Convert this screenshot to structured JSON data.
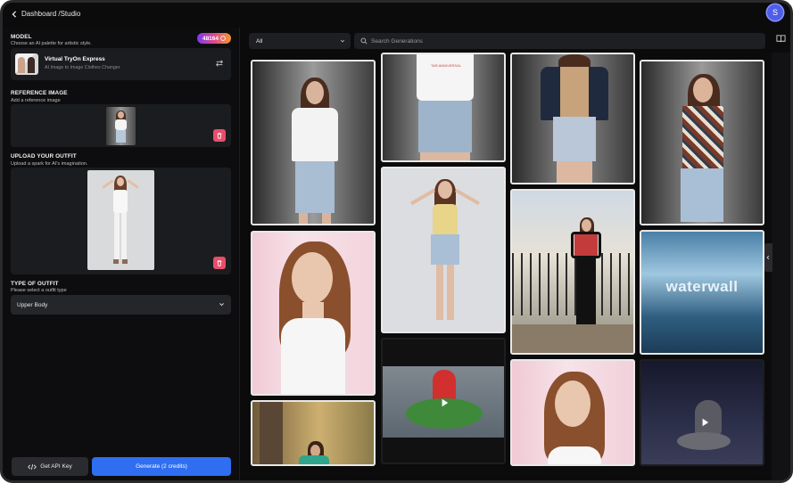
{
  "header": {
    "breadcrumb": "Dashboard /Studio",
    "avatar_initial": "S"
  },
  "model": {
    "title": "MODEL",
    "subtitle": "Choose an AI palette for artistic style.",
    "credits": "48164",
    "name": "Virtual TryOn Express",
    "description": "AI Image to Image Clothes Changer"
  },
  "reference": {
    "title": "REFERENCE IMAGE",
    "subtitle": "Add a reference image"
  },
  "outfit": {
    "title": "UPLOAD YOUR OUTFIT",
    "subtitle": "Upload a spark for AI's imagination."
  },
  "type": {
    "title": "TYPE OF OUTFIT",
    "subtitle": "Please select a outfit type",
    "value": "Upper Body"
  },
  "actions": {
    "api_label": "Get API Key",
    "generate_label": "Generate (2 credits)"
  },
  "gallery": {
    "filter_value": "All",
    "search_placeholder": "Search Generations",
    "waterwall_text": "waterwall",
    "shirt_text": "TAR ANNIVERSAL"
  },
  "colors": {
    "accent": "#2f6ef0",
    "trash": "#e84e6a",
    "avatar": "#4f5ee8"
  },
  "icons": [
    "chevron-left-icon",
    "code-icon",
    "trash-icon",
    "search-icon",
    "book-icon",
    "chevron-down-icon",
    "play-icon",
    "swap-icon"
  ]
}
